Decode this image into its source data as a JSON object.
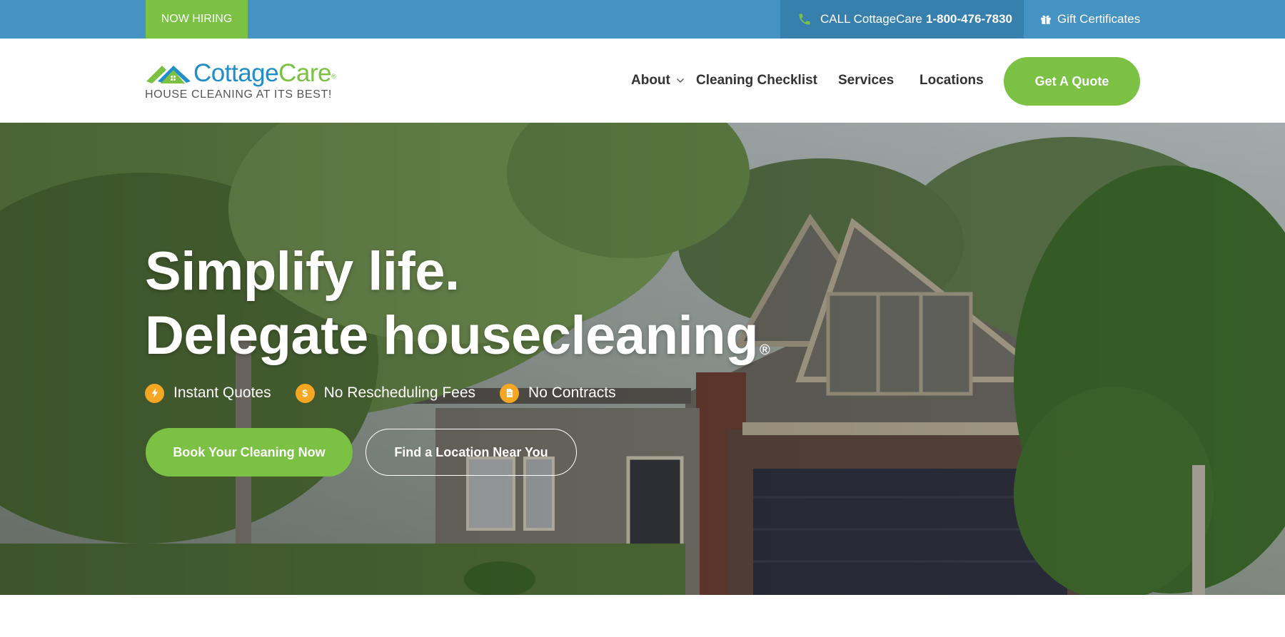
{
  "topbar": {
    "hiring_label": "NOW HIRING",
    "call_prefix": "CALL CottageCare",
    "call_number": "1-800-476-7830",
    "gift_label": "Gift Certificates"
  },
  "header": {
    "logo_name_part1": "Cottage",
    "logo_name_part2": "Care",
    "logo_tagline": "HOUSE CLEANING AT ITS BEST!",
    "nav": {
      "about": "About",
      "checklist": "Cleaning Checklist",
      "services": "Services",
      "locations": "Locations"
    },
    "quote_label": "Get A Quote"
  },
  "hero": {
    "title_line1": "Simplify life.",
    "title_line2": "Delegate housecleaning",
    "title_mark": "®",
    "features": [
      {
        "label": "Instant Quotes",
        "icon": "lightning-icon"
      },
      {
        "label": "No Rescheduling Fees",
        "icon": "dollar-icon"
      },
      {
        "label": "No Contracts",
        "icon": "document-icon"
      }
    ],
    "book_label": "Book Your Cleaning Now",
    "find_label": "Find a Location Near You"
  },
  "colors": {
    "topbar": "#4593c3",
    "call_bg": "#377fac",
    "green": "#7bc143",
    "blue": "#1f8ec9",
    "feature_icon": "#f5a623"
  }
}
